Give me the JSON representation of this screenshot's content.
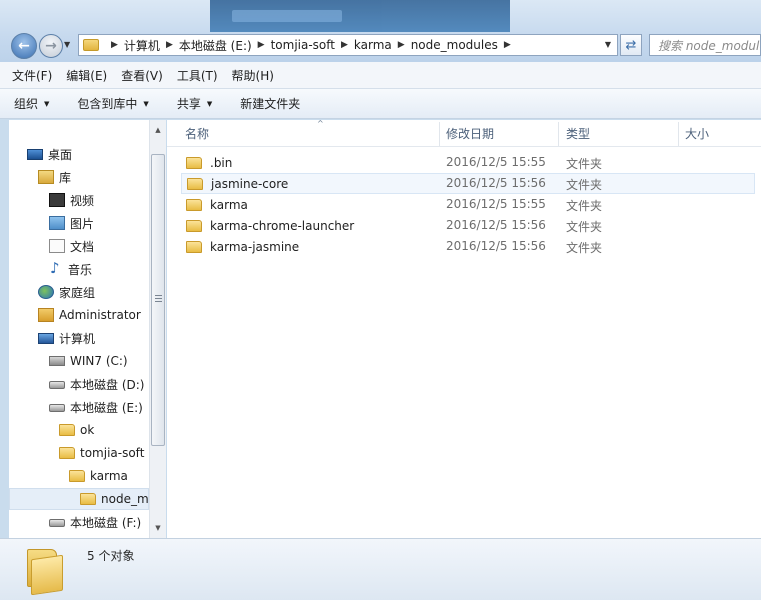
{
  "address": {
    "segments": [
      "计算机",
      "本地磁盘 (E:)",
      "tomjia-soft",
      "karma",
      "node_modules"
    ],
    "search_placeholder": "搜索 node_modules"
  },
  "menu": [
    "文件(F)",
    "编辑(E)",
    "查看(V)",
    "工具(T)",
    "帮助(H)"
  ],
  "toolbar": {
    "organize": "组织",
    "include_library": "包含到库中",
    "share": "共享",
    "new_folder": "新建文件夹"
  },
  "nav_tree": [
    {
      "label": "桌面",
      "icon": "desktop-icon"
    },
    {
      "label": "库",
      "icon": "library-icon"
    },
    {
      "label": "视频",
      "icon": "video-library-icon"
    },
    {
      "label": "图片",
      "icon": "picture-library-icon"
    },
    {
      "label": "文档",
      "icon": "document-library-icon"
    },
    {
      "label": "音乐",
      "icon": "music-library-icon"
    },
    {
      "label": "家庭组",
      "icon": "homegroup-icon"
    },
    {
      "label": "Administrator",
      "icon": "user-folder-icon"
    },
    {
      "label": "计算机",
      "icon": "computer-icon"
    },
    {
      "label": "WIN7 (C:)",
      "icon": "system-drive-icon"
    },
    {
      "label": "本地磁盘 (D:)",
      "icon": "drive-icon"
    },
    {
      "label": "本地磁盘 (E:)",
      "icon": "drive-icon"
    },
    {
      "label": "ok",
      "icon": "folder-icon"
    },
    {
      "label": "tomjia-soft",
      "icon": "folder-icon"
    },
    {
      "label": "karma",
      "icon": "folder-icon"
    },
    {
      "label": "node_mo",
      "icon": "folder-icon"
    },
    {
      "label": "本地磁盘 (F:)",
      "icon": "drive-icon"
    }
  ],
  "columns": {
    "name": "名称",
    "date": "修改日期",
    "type": "类型",
    "size": "大小"
  },
  "files": [
    {
      "name": ".bin",
      "date": "2016/12/5 15:55",
      "type": "文件夹"
    },
    {
      "name": "jasmine-core",
      "date": "2016/12/5 15:56",
      "type": "文件夹"
    },
    {
      "name": "karma",
      "date": "2016/12/5 15:55",
      "type": "文件夹"
    },
    {
      "name": "karma-chrome-launcher",
      "date": "2016/12/5 15:56",
      "type": "文件夹"
    },
    {
      "name": "karma-jasmine",
      "date": "2016/12/5 15:56",
      "type": "文件夹"
    }
  ],
  "status": "5 个对象"
}
